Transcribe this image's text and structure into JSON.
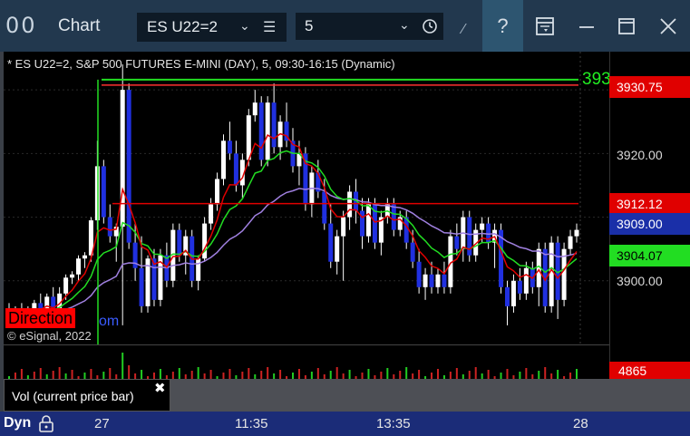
{
  "window": {
    "title": "Chart",
    "logo_text": "00",
    "symbol": "ES U22=2",
    "interval": "5",
    "buttons": [
      "help-icon",
      "layout-icon",
      "minimize-icon",
      "maximize-icon",
      "close-icon"
    ]
  },
  "chart": {
    "header": "* ES U22=2, S&P 500 FUTURES E-MINI (DAY), 5, 09:30-16:15 (Dynamic)",
    "top_level_label": "393",
    "price_labels": [
      {
        "value": "3930.75",
        "color": "#e00000",
        "text_color": "#ffffff"
      },
      {
        "value": "3912.12",
        "color": "#e00000",
        "text_color": "#ffffff"
      },
      {
        "value": "3909.00",
        "color": "#1a2fa8",
        "text_color": "#ffffff"
      },
      {
        "value": "3904.07",
        "color": "#22dd22",
        "text_color": "#000000"
      }
    ],
    "price_ticks": [
      "3920.00",
      "3900.00"
    ],
    "direction_label": "Direction",
    "com_text": "om",
    "copyright": "© eSignal, 2022"
  },
  "volume": {
    "label": "Vol (current price bar)",
    "close_symbol": "✖",
    "value": "4865"
  },
  "time_axis": {
    "mode": "Dyn",
    "labels": [
      "27",
      "11:35",
      "13:35",
      "28"
    ]
  },
  "chart_data": {
    "type": "candlestick",
    "ylim": [
      3890,
      3936
    ],
    "ticks": [
      3900,
      3920
    ],
    "ohlc": [
      [
        3895,
        3896.5,
        3893.5,
        3894.5
      ],
      [
        3894.5,
        3896,
        3894,
        3895.5
      ],
      [
        3895.5,
        3896.5,
        3894,
        3894.6
      ],
      [
        3894.6,
        3896,
        3893.6,
        3895.5
      ],
      [
        3895.5,
        3897,
        3895,
        3896.5
      ],
      [
        3896.5,
        3898,
        3895.5,
        3895.6
      ],
      [
        3895.6,
        3898,
        3895,
        3897.5
      ],
      [
        3897.5,
        3899,
        3896,
        3895
      ],
      [
        3895,
        3899,
        3894,
        3898
      ],
      [
        3898,
        3901,
        3897,
        3900.5
      ],
      [
        3900.5,
        3901.5,
        3899.5,
        3901
      ],
      [
        3901,
        3904,
        3900,
        3903.5
      ],
      [
        3903.5,
        3904.5,
        3902,
        3904
      ],
      [
        3904,
        3910,
        3903,
        3909.5
      ],
      [
        3909.5,
        3922,
        3908,
        3918
      ],
      [
        3918,
        3919,
        3909,
        3910
      ],
      [
        3910,
        3912,
        3906,
        3907
      ],
      [
        3907,
        3909,
        3903,
        3908.5
      ],
      [
        3908.5,
        3934,
        3893,
        3930
      ],
      [
        3930,
        3931,
        3905,
        3906
      ],
      [
        3906,
        3909,
        3900,
        3902
      ],
      [
        3902,
        3907,
        3895,
        3896
      ],
      [
        3896,
        3904,
        3895,
        3903.5
      ],
      [
        3903.5,
        3905,
        3896,
        3897
      ],
      [
        3897,
        3905,
        3896,
        3904
      ],
      [
        3904,
        3906,
        3899,
        3900
      ],
      [
        3900,
        3909,
        3899,
        3908
      ],
      [
        3908,
        3909,
        3903,
        3904
      ],
      [
        3904,
        3908,
        3901,
        3907
      ],
      [
        3907,
        3908,
        3899,
        3900
      ],
      [
        3900,
        3904,
        3898.5,
        3903.5
      ],
      [
        3903.5,
        3910,
        3903,
        3909
      ],
      [
        3909,
        3913,
        3908,
        3912
      ],
      [
        3912,
        3917,
        3911,
        3916
      ],
      [
        3916,
        3923,
        3915,
        3922
      ],
      [
        3922,
        3925,
        3919,
        3920
      ],
      [
        3920,
        3922,
        3914,
        3915
      ],
      [
        3915,
        3920,
        3913,
        3919
      ],
      [
        3919,
        3927,
        3918,
        3926
      ],
      [
        3926,
        3930,
        3925,
        3928
      ],
      [
        3928,
        3929,
        3918,
        3919
      ],
      [
        3919,
        3929,
        3918,
        3928
      ],
      [
        3928,
        3931,
        3920,
        3921
      ],
      [
        3921,
        3926,
        3919,
        3925
      ],
      [
        3925,
        3928,
        3921,
        3922
      ],
      [
        3922,
        3924,
        3917,
        3918
      ],
      [
        3918,
        3922,
        3915,
        3920
      ],
      [
        3920,
        3921,
        3911,
        3912
      ],
      [
        3912,
        3918,
        3910,
        3917
      ],
      [
        3917,
        3919,
        3913,
        3914
      ],
      [
        3914,
        3916,
        3908,
        3909
      ],
      [
        3909,
        3912,
        3902,
        3903
      ],
      [
        3903,
        3908,
        3901,
        3907
      ],
      [
        3907,
        3911,
        3900,
        3910
      ],
      [
        3910,
        3915,
        3908,
        3914
      ],
      [
        3914,
        3916,
        3909,
        3911
      ],
      [
        3911,
        3913,
        3905,
        3907
      ],
      [
        3907,
        3913,
        3906,
        3912
      ],
      [
        3912,
        3913,
        3905,
        3906
      ],
      [
        3906,
        3911,
        3904,
        3910
      ],
      [
        3910,
        3913,
        3909,
        3912
      ],
      [
        3912,
        3913,
        3907,
        3908
      ],
      [
        3908,
        3911,
        3907,
        3910
      ],
      [
        3910,
        3911,
        3905,
        3906
      ],
      [
        3906,
        3908,
        3902,
        3903
      ],
      [
        3903,
        3905,
        3898,
        3899
      ],
      [
        3899,
        3902,
        3897,
        3901
      ],
      [
        3901,
        3903,
        3898,
        3899
      ],
      [
        3899,
        3902,
        3898,
        3901
      ],
      [
        3901,
        3903,
        3898,
        3899
      ],
      [
        3899,
        3908,
        3898,
        3907
      ],
      [
        3907,
        3909,
        3904,
        3905
      ],
      [
        3905,
        3911,
        3903,
        3910
      ],
      [
        3910,
        3911,
        3903,
        3904
      ],
      [
        3904,
        3909,
        3903,
        3908
      ],
      [
        3908,
        3910,
        3906,
        3909
      ],
      [
        3909,
        3910,
        3905,
        3906
      ],
      [
        3906,
        3909,
        3902,
        3908
      ],
      [
        3908,
        3909,
        3898,
        3899
      ],
      [
        3899,
        3900,
        3893,
        3896
      ],
      [
        3896,
        3901,
        3895,
        3900
      ],
      [
        3900,
        3902,
        3897,
        3898
      ],
      [
        3898,
        3903,
        3897,
        3902
      ],
      [
        3902,
        3903,
        3898,
        3899
      ],
      [
        3899,
        3906,
        3896,
        3905
      ],
      [
        3905,
        3906,
        3895,
        3896
      ],
      [
        3896,
        3907,
        3895,
        3906
      ],
      [
        3906,
        3907,
        3894,
        3897
      ],
      [
        3897,
        3906,
        3896,
        3905
      ],
      [
        3905,
        3908,
        3904,
        3907
      ],
      [
        3907,
        3909,
        3906,
        3908
      ]
    ],
    "overlays": [
      {
        "color": "#ff2020",
        "values": [
          3930.75,
          3930.75,
          3930.75,
          3930.75
        ]
      },
      {
        "color": "#e00000",
        "values": [
          3912.12,
          3912.12
        ]
      },
      {
        "color": "#a080e0",
        "values": [
          3909.0,
          3909.0
        ]
      },
      {
        "color": "#22dd22",
        "values": [
          3904.07,
          3904.07
        ]
      }
    ]
  }
}
